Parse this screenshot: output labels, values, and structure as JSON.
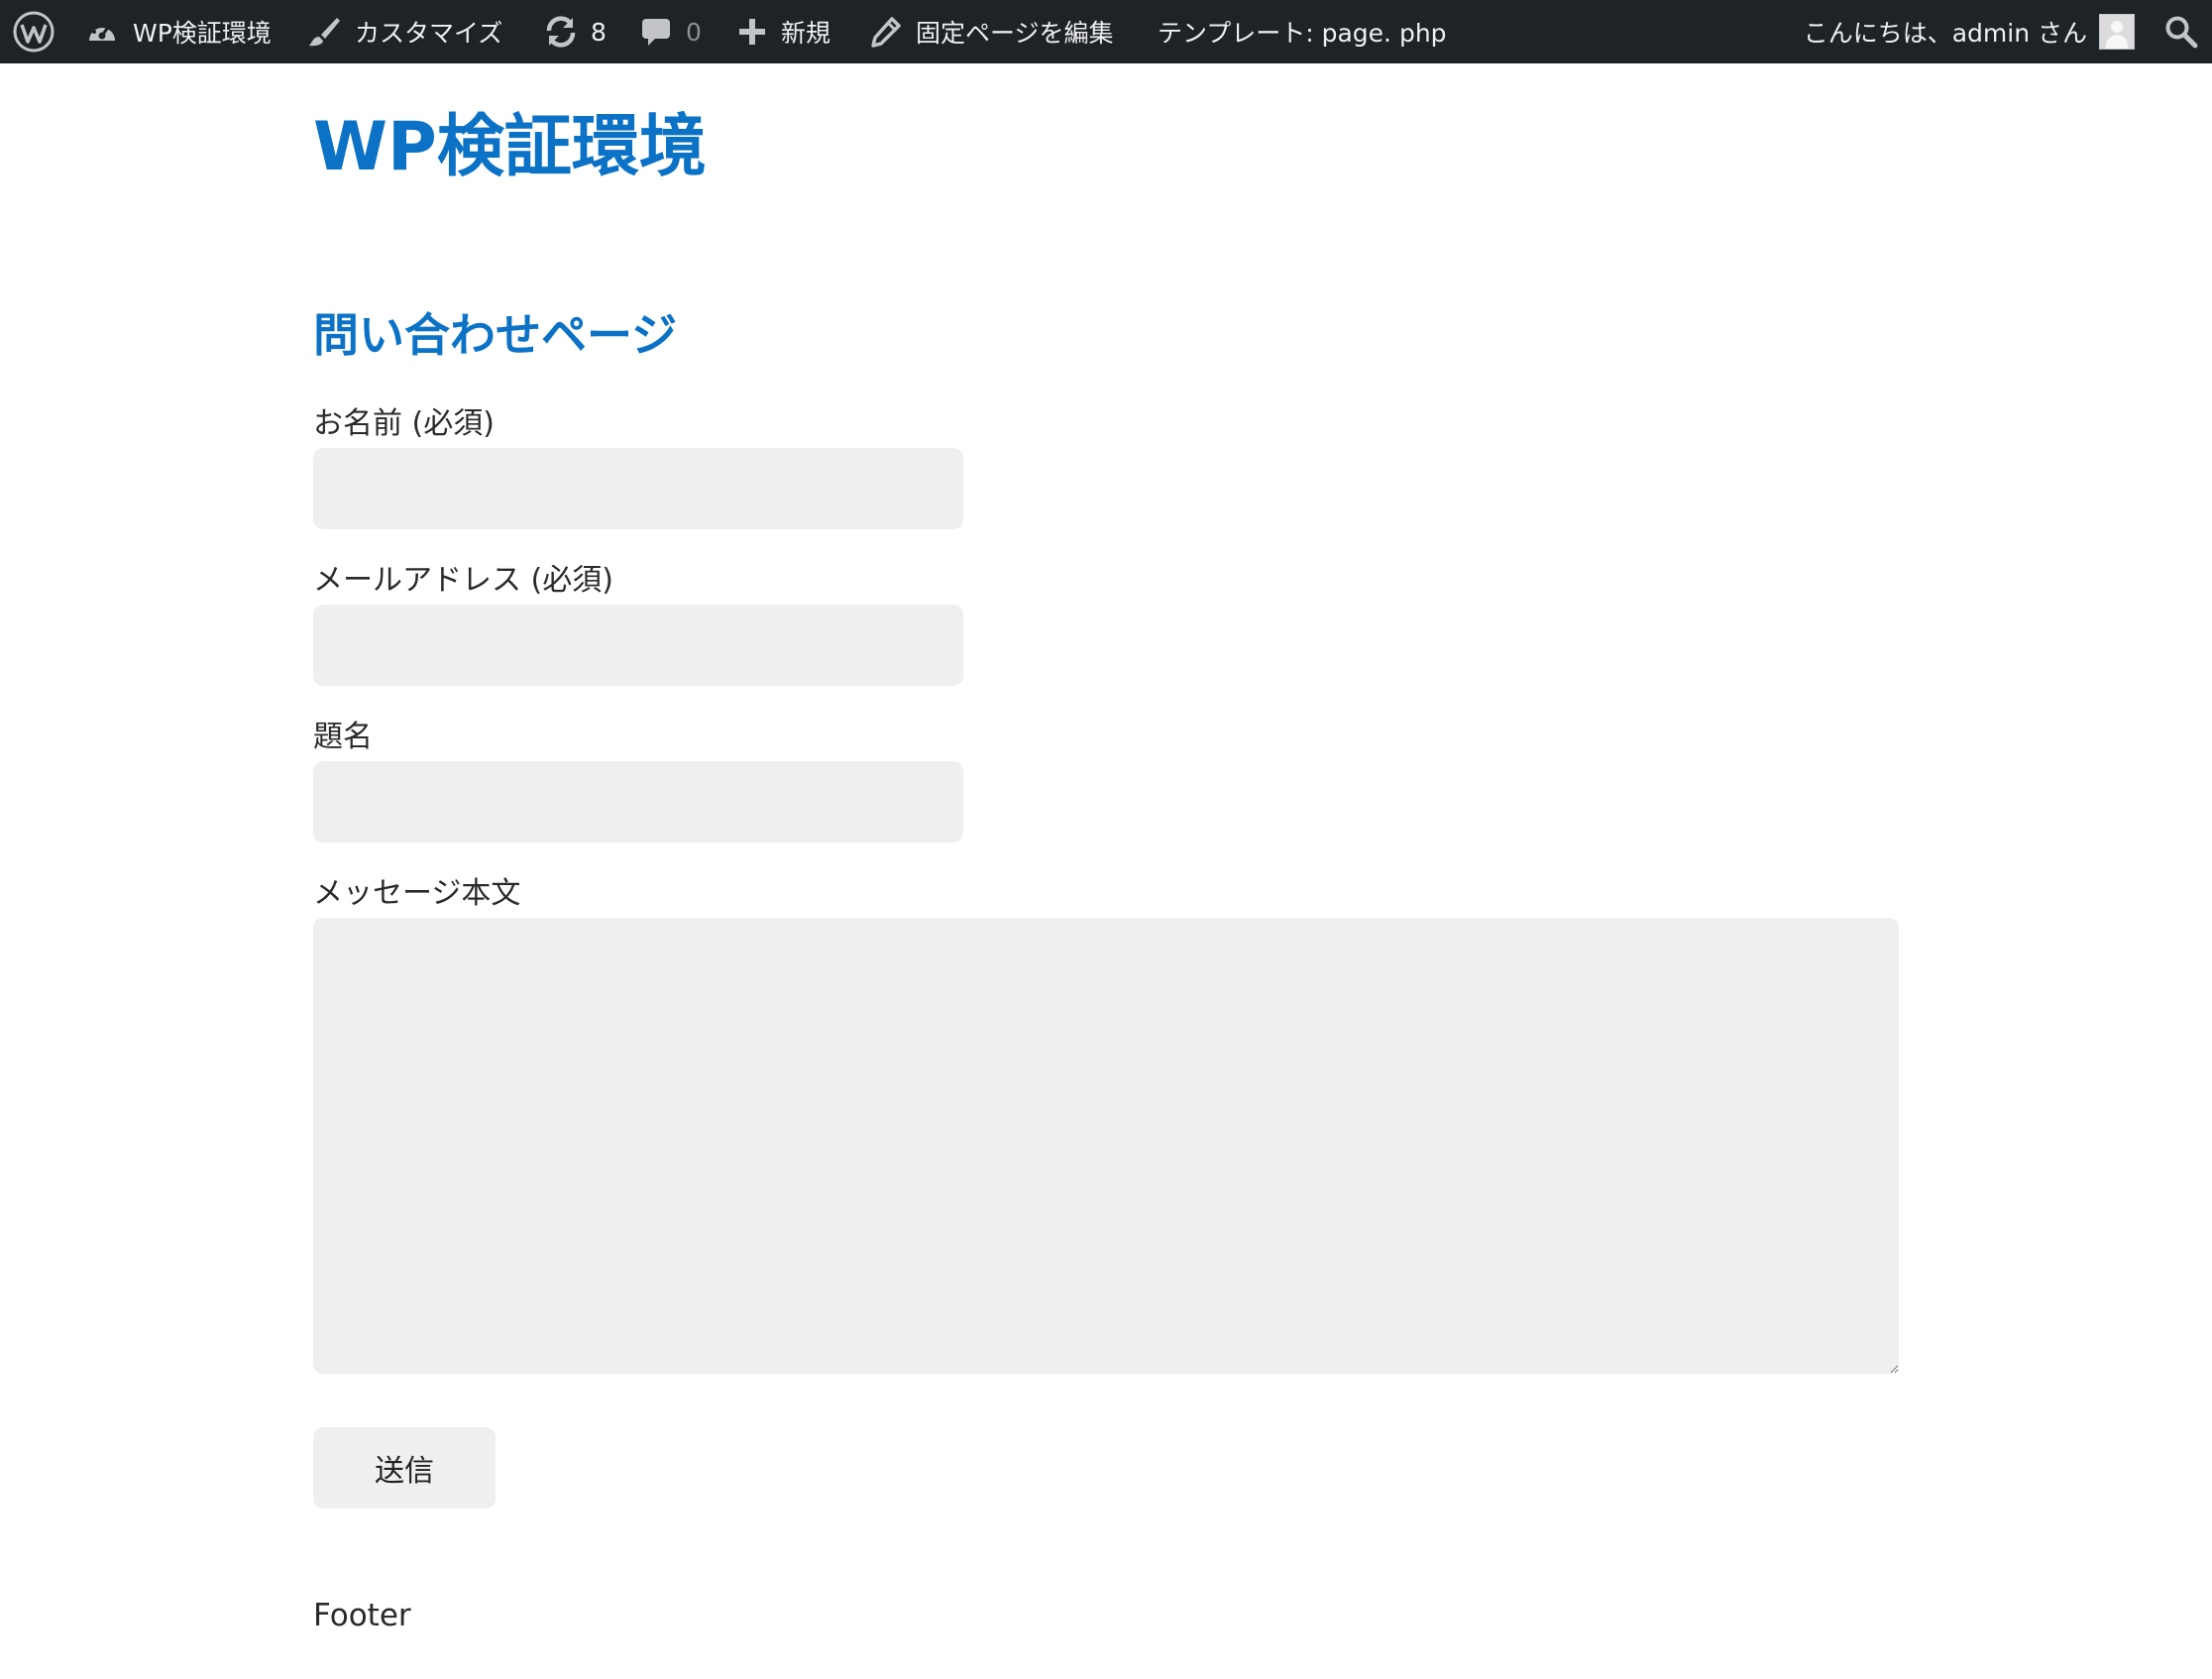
{
  "adminbar": {
    "site_name": "WP検証環境",
    "customize_label": "カスタマイズ",
    "updates_count": "8",
    "comments_count": "0",
    "new_label": "新規",
    "edit_label": "固定ページを編集",
    "template_label": "テンプレート: page. php",
    "greeting": "こんにちは、admin さん",
    "background_color": "#1d2327"
  },
  "site": {
    "title": "WP検証環境",
    "accent_color": "#0b72c6"
  },
  "page": {
    "title": "問い合わせページ"
  },
  "form": {
    "name_label": "お名前 (必須)",
    "name_value": "",
    "email_label": "メールアドレス (必須)",
    "email_value": "",
    "subject_label": "題名",
    "subject_value": "",
    "message_label": "メッセージ本文",
    "message_value": "",
    "submit_label": "送信"
  },
  "footer": {
    "text": "Footer"
  }
}
